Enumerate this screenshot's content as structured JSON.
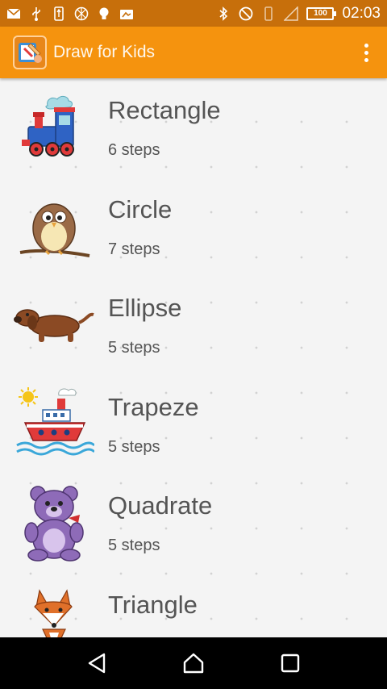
{
  "status_bar": {
    "time": "02:03",
    "battery": "100",
    "left_icons": [
      "mail-icon",
      "usb-icon",
      "usb-storage-icon",
      "aperture-icon",
      "bulb-icon",
      "photo-icon"
    ],
    "right_icons": [
      "bluetooth-icon",
      "dnd-icon",
      "vibrate-icon",
      "signal-icon",
      "battery-icon"
    ]
  },
  "app_bar": {
    "title": "Draw for Kids",
    "overflow_icon": "more-vert-icon",
    "color": "#f5930e"
  },
  "items": [
    {
      "title": "Rectangle",
      "steps": "6 steps",
      "image": "train-icon"
    },
    {
      "title": "Circle",
      "steps": "7 steps",
      "image": "owl-icon"
    },
    {
      "title": "Ellipse",
      "steps": "5 steps",
      "image": "dachshund-icon"
    },
    {
      "title": "Trapeze",
      "steps": "5 steps",
      "image": "ship-icon"
    },
    {
      "title": "Quadrate",
      "steps": "5 steps",
      "image": "teddy-bear-icon"
    },
    {
      "title": "Triangle",
      "steps": "",
      "image": "fox-icon"
    }
  ],
  "nav_bar": {
    "icons": [
      "back-icon",
      "home-icon",
      "recents-icon"
    ]
  }
}
